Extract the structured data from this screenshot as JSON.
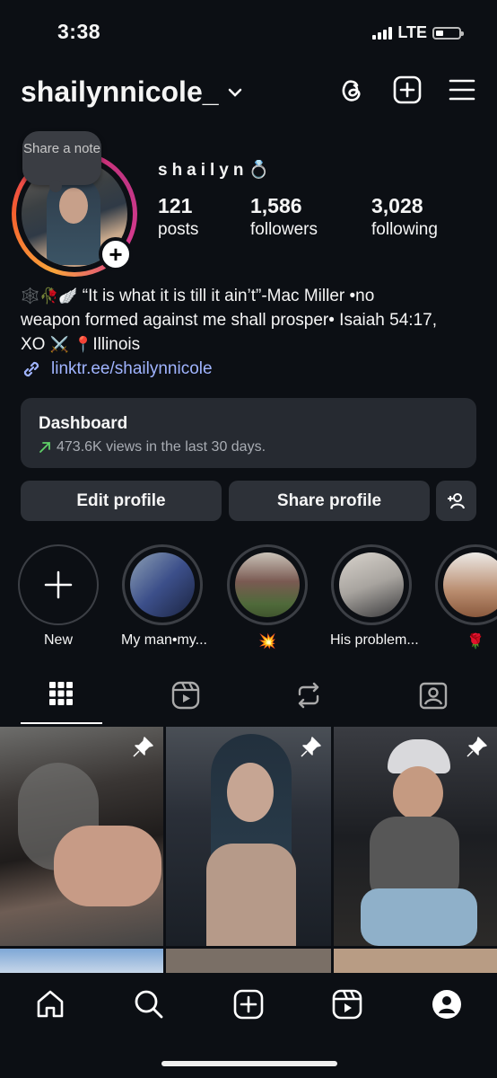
{
  "status_bar": {
    "time": "3:38",
    "network": "LTE",
    "battery_fraction": 0.3
  },
  "header": {
    "username": "shailynnicole_",
    "icons": [
      "chevron-down-icon",
      "threads-icon",
      "new-post-icon",
      "menu-icon"
    ]
  },
  "profile": {
    "note_label": "Share a note",
    "display_name": "shailyn💍",
    "stats": [
      {
        "value": "121",
        "label": "posts"
      },
      {
        "value": "1,586",
        "label": "followers"
      },
      {
        "value": "3,028",
        "label": "following"
      }
    ],
    "bio_line1": "“It is what it is till it ain’t”-Mac Miller •no",
    "bio_line2": "weapon formed against me shall prosper• Isaiah 54:17,",
    "bio_line3_prefix": "XO",
    "bio_line3_suffix": "Illinois",
    "bio_emojis": [
      "🕸️",
      "🥀",
      "🪽",
      "⚔️",
      "📍"
    ],
    "link_text": "linktr.ee/shailynnicole"
  },
  "dashboard": {
    "title": "Dashboard",
    "subtitle": "473.6K views in the last 30 days.",
    "trend_color": "#5fd068"
  },
  "actions": {
    "edit_label": "Edit profile",
    "share_label": "Share profile"
  },
  "highlights": [
    {
      "label": "New"
    },
    {
      "label": "My man•my..."
    },
    {
      "label": "💥"
    },
    {
      "label": "His problem..."
    },
    {
      "label": "🌹"
    }
  ],
  "tabs": [
    "grid-icon",
    "reels-icon",
    "reposts-icon",
    "tagged-icon"
  ],
  "bottom_nav": [
    "home-icon",
    "search-icon",
    "create-icon",
    "reels-icon",
    "profile-icon"
  ],
  "colors": {
    "background": "#0c0f14",
    "link": "#a0b4ff",
    "surface": "#262a31"
  }
}
